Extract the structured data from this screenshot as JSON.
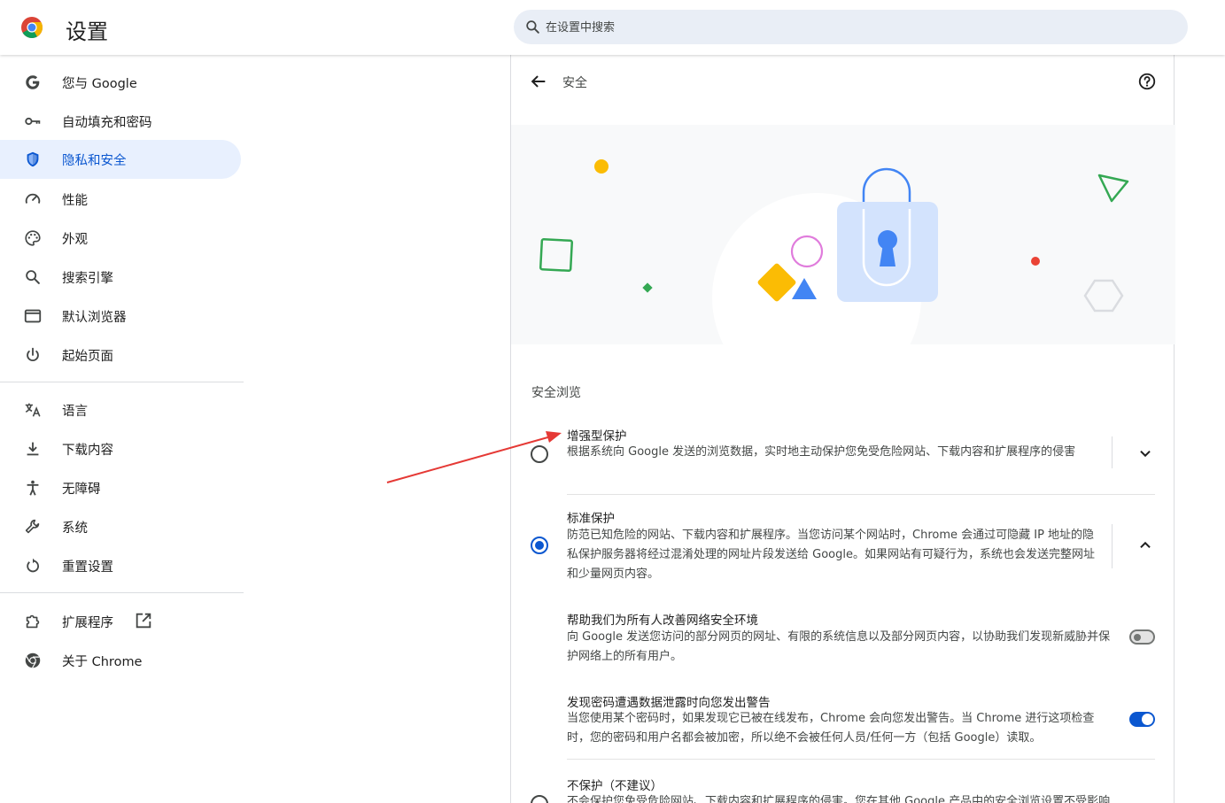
{
  "header": {
    "title": "设置",
    "search_placeholder": "在设置中搜索"
  },
  "sidebar": {
    "items": [
      {
        "label": "您与 Google",
        "icon": "google-g-icon"
      },
      {
        "label": "自动填充和密码",
        "icon": "key-icon"
      },
      {
        "label": "隐私和安全",
        "icon": "shield-icon",
        "active": true
      },
      {
        "label": "性能",
        "icon": "speedometer-icon"
      },
      {
        "label": "外观",
        "icon": "palette-icon"
      },
      {
        "label": "搜索引擎",
        "icon": "search-icon"
      },
      {
        "label": "默认浏览器",
        "icon": "browser-window-icon"
      },
      {
        "label": "起始页面",
        "icon": "power-icon"
      },
      {
        "label": "语言",
        "icon": "translate-icon"
      },
      {
        "label": "下载内容",
        "icon": "download-icon"
      },
      {
        "label": "无障碍",
        "icon": "accessibility-icon"
      },
      {
        "label": "系统",
        "icon": "wrench-icon"
      },
      {
        "label": "重置设置",
        "icon": "reset-icon"
      },
      {
        "label": "扩展程序",
        "icon": "puzzle-icon"
      },
      {
        "label": "关于 Chrome",
        "icon": "chrome-icon"
      }
    ]
  },
  "page": {
    "title": "安全",
    "section_title": "安全浏览",
    "options": [
      {
        "title": "增强型保护",
        "desc": "根据系统向 Google 发送的浏览数据，实时地主动保护您免受危险网站、下载内容和扩展程序的侵害",
        "checked": false,
        "expanded": false
      },
      {
        "title": "标准保护",
        "desc": "防范已知危险的网站、下载内容和扩展程序。当您访问某个网站时，Chrome 会通过可隐藏 IP 地址的隐私保护服务器将经过混淆处理的网址片段发送给 Google。如果网站有可疑行为，系统也会发送完整网址和少量网页内容。",
        "checked": true,
        "expanded": true
      },
      {
        "title": "不保护（不建议）",
        "desc": "不会保护您免受危险网站、下载内容和扩展程序的侵害。您在其他 Google 产品中的安全浏览设置不受影响",
        "checked": false
      }
    ],
    "sub_settings": [
      {
        "title": "帮助我们为所有人改善网络安全环境",
        "desc": "向 Google 发送您访问的部分网页的网址、有限的系统信息以及部分网页内容，以协助我们发现新威胁并保护网络上的所有用户。",
        "enabled": false
      },
      {
        "title": "发现密码遭遇数据泄露时向您发出警告",
        "desc": "当您使用某个密码时，如果发现它已被在线发布，Chrome 会向您发出警告。当 Chrome 进行这项检查时，您的密码和用户名都会被加密，所以绝不会被任何人员/任何一方（包括 Google）读取。",
        "enabled": true
      }
    ]
  },
  "colors": {
    "accent": "#0b57d0",
    "active_bg": "#e8f0fe",
    "search_bg": "#e9eef6",
    "annotation_arrow": "#e53935"
  }
}
